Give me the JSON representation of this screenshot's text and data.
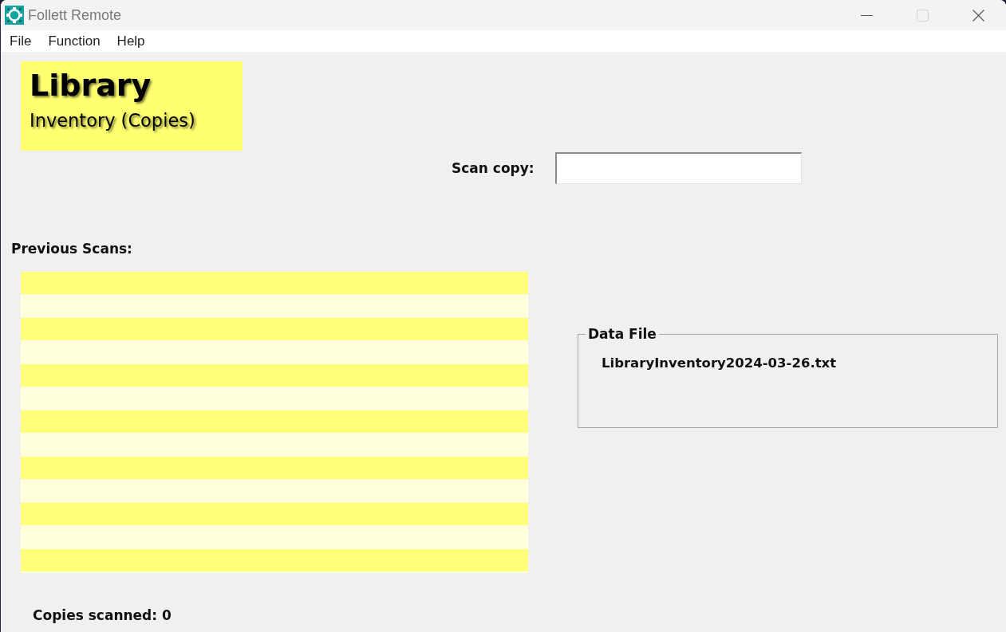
{
  "window": {
    "title": "Follett Remote",
    "controls": [
      {
        "kind": "minimize",
        "disabled": false
      },
      {
        "kind": "maximize",
        "disabled": true
      },
      {
        "kind": "close",
        "disabled": false
      }
    ]
  },
  "menu": [
    "File",
    "Function",
    "Help"
  ],
  "banner": {
    "title": "Library",
    "subtitle": "Inventory (Copies)"
  },
  "scan_field": {
    "label": "Scan copy:"
  },
  "previous_scans": {
    "label": "Previous Scans:"
  },
  "data_file": {
    "legend": "Data File",
    "file_name": "LibraryInventory2024-03-26.txt"
  },
  "status": {
    "copies_scanned": "Copies scanned: 0"
  }
}
